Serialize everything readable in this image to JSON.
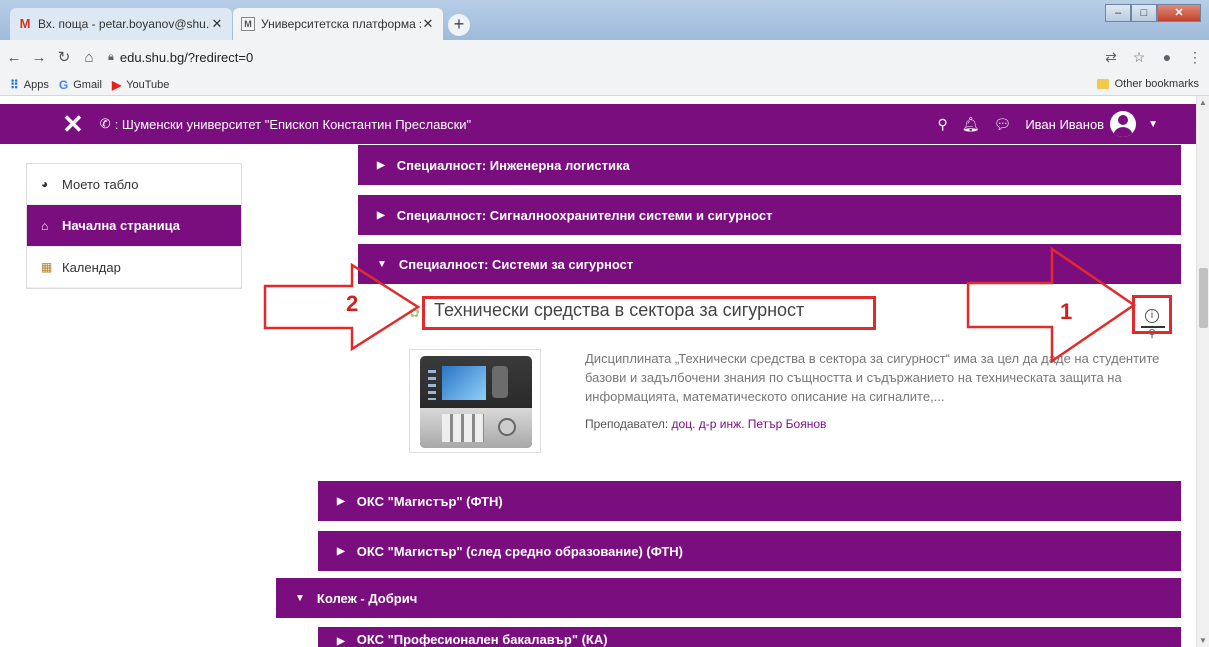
{
  "browser": {
    "tabs": [
      {
        "title": "Вх. поща - petar.boyanov@shu.b",
        "icon": "gmail-icon"
      },
      {
        "title": "Университетска платформа за с",
        "icon": "moodle-icon"
      }
    ],
    "url": "edu.shu.bg/?redirect=0",
    "bookmarks": [
      {
        "label": "Apps",
        "icon": "apps-grid-icon"
      },
      {
        "label": "Gmail",
        "icon": "google-icon"
      },
      {
        "label": "YouTube",
        "icon": "youtube-icon"
      }
    ],
    "other_bookmarks": "Other bookmarks"
  },
  "header": {
    "site_name": ": Шуменски университет \"Епископ Константин Преславски\"",
    "user_name": "Иван Иванов"
  },
  "leftnav": [
    {
      "label": "Моето табло",
      "icon": "dashboard-icon"
    },
    {
      "label": "Начална страница",
      "icon": "home-icon"
    },
    {
      "label": "Календар",
      "icon": "calendar-icon"
    }
  ],
  "categories": {
    "c1": "Специалност: Инженерна логистика",
    "c2": "Специалност: Сигналноохранителни системи и сигурност",
    "c3": "Специалност: Системи за сигурност",
    "c4": "ОКС \"Магистър\" (ФТН)",
    "c5": "ОКС \"Магистър\" (след средно образование) (ФТН)",
    "c6": "Колеж - Добрич",
    "c7": "ОКС \"Професионален бакалавър\" (КА)"
  },
  "course": {
    "name": "Технически средства в сектора за сигурност",
    "summary": "Дисциплината „Технически средства в сектора за сигурност“ има за цел да даде на студентите базови и задълбочени знания по същността и съдържанието на техническата защита на информацията, математическото описание на сигналите,...",
    "teacher_label": "Преподавател:",
    "teacher_name": "доц. д-р инж. Петър Боянов"
  },
  "annotations": {
    "label_1": "1",
    "label_2": "2"
  },
  "colors": {
    "brand": "#7b0e7f",
    "annotation": "#e22a2a"
  }
}
